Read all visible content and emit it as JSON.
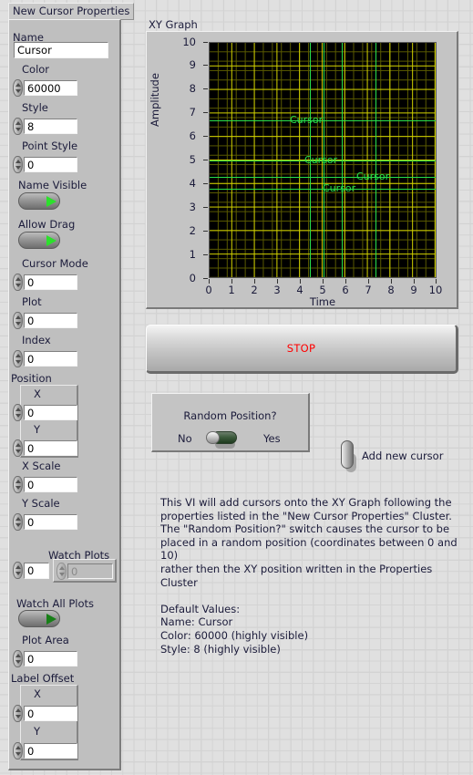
{
  "cluster": {
    "title": "New Cursor Properties",
    "fields": {
      "name_label": "Name",
      "name_value": "Cursor",
      "color_label": "Color",
      "color_value": "60000",
      "style_label": "Style",
      "style_value": "8",
      "point_style_label": "Point Style",
      "point_style_value": "0",
      "name_visible_label": "Name Visible",
      "allow_drag_label": "Allow Drag",
      "cursor_mode_label": "Cursor Mode",
      "cursor_mode_value": "0",
      "plot_label": "Plot",
      "plot_value": "0",
      "index_label": "Index",
      "index_value": "0",
      "position_label": "Position",
      "position_x_label": "X",
      "position_x_value": "0",
      "position_y_label": "Y",
      "position_y_value": "0",
      "x_scale_label": "X Scale",
      "x_scale_value": "0",
      "y_scale_label": "Y Scale",
      "y_scale_value": "0",
      "watch_plots_label": "Watch Plots",
      "watch_plots_index": "0",
      "watch_plots_element": "0",
      "watch_all_plots_label": "Watch All Plots",
      "plot_area_label": "Plot Area",
      "plot_area_value": "0",
      "label_offset_label": "Label Offset",
      "label_offset_x_label": "X",
      "label_offset_x_value": "0",
      "label_offset_y_label": "Y",
      "label_offset_y_value": "0"
    },
    "switch_states": {
      "name_visible": "on",
      "allow_drag": "on",
      "watch_all_plots": "off"
    }
  },
  "graph": {
    "title": "XY Graph"
  },
  "chart_data": {
    "type": "scatter",
    "title": "XY Graph",
    "xlabel": "Time",
    "ylabel": "Amplitude",
    "xlim": [
      0,
      10
    ],
    "ylim": [
      0,
      10
    ],
    "xticks": [
      "0",
      "1",
      "2",
      "3",
      "4",
      "5",
      "6",
      "7",
      "8",
      "9",
      "10"
    ],
    "yticks": [
      "0",
      "1",
      "2",
      "3",
      "4",
      "5",
      "6",
      "7",
      "8",
      "9",
      "10"
    ],
    "grid": true,
    "grid_color": "#d4d400",
    "plot_background": "#000000",
    "cursor_color": "#27e04c",
    "series": [],
    "cursors": [
      {
        "label": "Cursor",
        "x": 4.4,
        "y": 6.7
      },
      {
        "label": "Cursor",
        "x": 5.0,
        "y": 5.0
      },
      {
        "label": "Cursor",
        "x": 7.3,
        "y": 4.3
      },
      {
        "label": "Cursor",
        "x": 5.8,
        "y": 3.8
      }
    ]
  },
  "stop_button": {
    "label": "STOP",
    "color": "#ff0000"
  },
  "random_position": {
    "title": "Random Position?",
    "off_label": "No",
    "on_label": "Yes",
    "state": "No"
  },
  "add_cursor": {
    "label": "Add new cursor",
    "state": "up"
  },
  "description": {
    "text": "This VI will add cursors onto the XY Graph following the\nproperties listed in the \"New Cursor Properties\" Cluster.\nThe \"Random Position?\" switch causes the cursor to be\nplaced in a random position (coordinates between 0 and 10)\nrather then the XY position written in the Properties Cluster\n\nDefault Values:\nName: Cursor\nColor: 60000 (highly visible)\nStyle: 8 (highly visible)"
  }
}
